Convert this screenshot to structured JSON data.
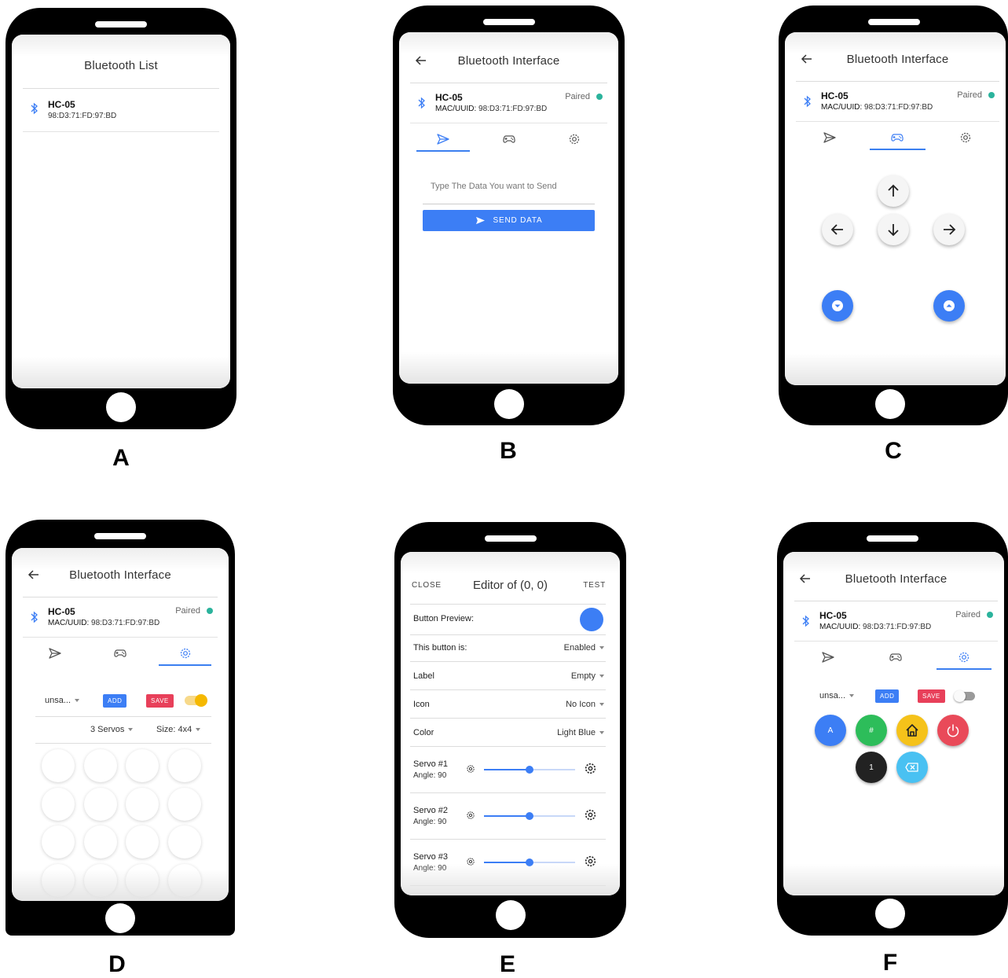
{
  "colors": {
    "accent": "#3c7ef5",
    "paired_dot": "#2bb39c",
    "save": "#e8405a",
    "toggle_on": "#f5b800",
    "panel_green": "#2dbd5a",
    "panel_yellow": "#f5c21a",
    "panel_red": "#e94a59",
    "panel_black": "#222222",
    "panel_cyan": "#49c1f2"
  },
  "device": {
    "name": "HC-05",
    "mac": "98:D3:71:FD:97:BD",
    "mac_label": "MAC/UUID:",
    "status": "Paired"
  },
  "icons": {
    "back": "arrow-left-icon",
    "bluetooth": "bluetooth-icon",
    "send": "send-icon",
    "gamepad": "gamepad-icon",
    "settings": "gear-icon"
  },
  "panels": {
    "a": {
      "letter": "A",
      "title": "Bluetooth List"
    },
    "b": {
      "letter": "B",
      "title": "Bluetooth Interface",
      "input_placeholder": "Type The Data You want to Send",
      "send_label": "SEND DATA"
    },
    "c": {
      "letter": "C",
      "title": "Bluetooth Interface"
    },
    "d": {
      "letter": "D",
      "title": "Bluetooth Interface",
      "layout_select": "unsa...",
      "add_label": "ADD",
      "save_label": "SAVE",
      "servos_select": "3 Servos",
      "size_select": "Size: 4x4"
    },
    "e": {
      "letter": "E",
      "close_label": "CLOSE",
      "title": "Editor of (0, 0)",
      "test_label": "TEST",
      "preview_label": "Button Preview:",
      "rows": [
        {
          "label": "This button is:",
          "value": "Enabled"
        },
        {
          "label": "Label",
          "value": "Empty"
        },
        {
          "label": "Icon",
          "value": "No Icon"
        },
        {
          "label": "Color",
          "value": "Light Blue"
        }
      ],
      "servos": [
        {
          "name": "Servo #1",
          "angle": "Angle: 90",
          "value": 90
        },
        {
          "name": "Servo #2",
          "angle": "Angle: 90",
          "value": 90
        },
        {
          "name": "Servo #3",
          "angle": "Angle: 90",
          "value": 90
        }
      ],
      "servo_range": [
        0,
        180
      ]
    },
    "f": {
      "letter": "F",
      "title": "Bluetooth Interface",
      "layout_select": "unsa...",
      "add_label": "ADD",
      "save_label": "SAVE",
      "btn_a": "A",
      "btn_hash": "#",
      "btn_one": "1"
    }
  }
}
